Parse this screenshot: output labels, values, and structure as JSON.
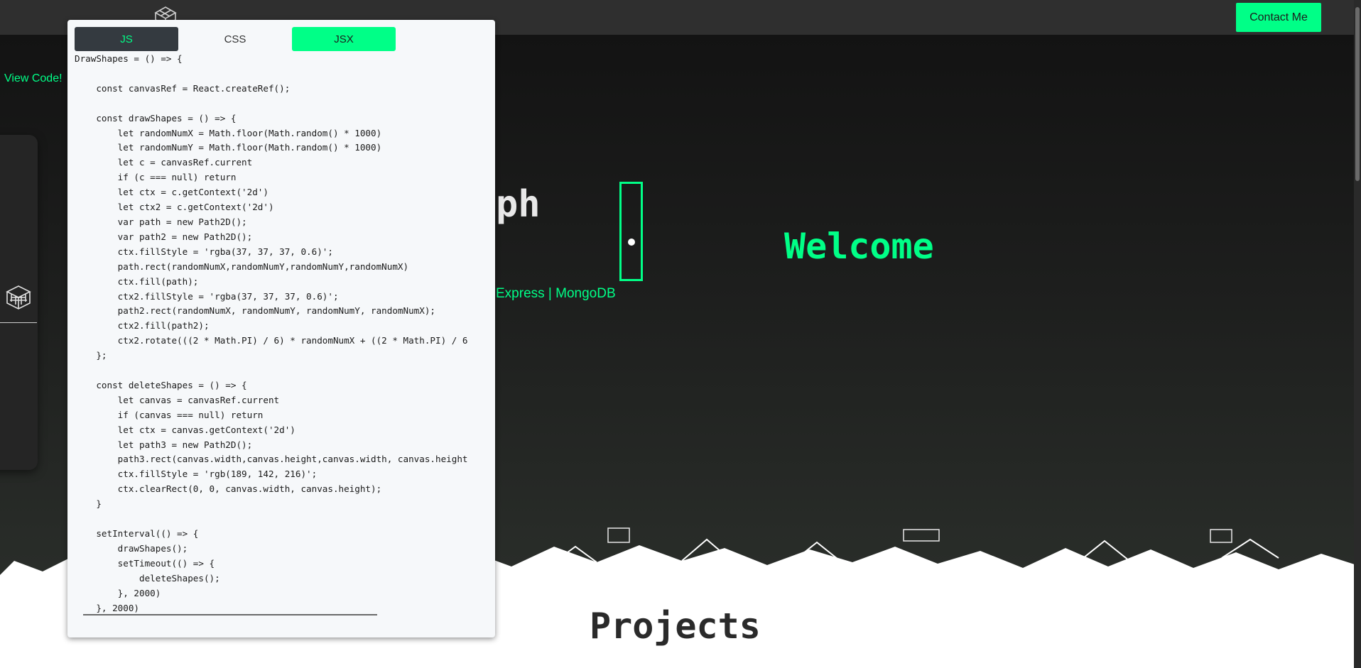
{
  "topbar": {
    "contact_label": "Contact Me"
  },
  "sidebar": {
    "view_code_label": "View Code!"
  },
  "hero": {
    "name_partial": "ph",
    "tech_stack_partial": "Express | MongoDB",
    "welcome": "Welcome"
  },
  "section": {
    "projects_title": "Projects"
  },
  "code_modal": {
    "tabs": [
      {
        "label": "JS",
        "state": "active"
      },
      {
        "label": "CSS",
        "state": "inactive"
      },
      {
        "label": "JSX",
        "state": "highlighted"
      }
    ],
    "code": "DrawShapes = () => {\n\n    const canvasRef = React.createRef();\n\n    const drawShapes = () => {\n        let randomNumX = Math.floor(Math.random() * 1000)\n        let randomNumY = Math.floor(Math.random() * 1000)\n        let c = canvasRef.current\n        if (c === null) return\n        let ctx = c.getContext('2d')\n        let ctx2 = c.getContext('2d')\n        var path = new Path2D();\n        var path2 = new Path2D();\n        ctx.fillStyle = 'rgba(37, 37, 37, 0.6)';\n        path.rect(randomNumX,randomNumY,randomNumY,randomNumX)\n        ctx.fill(path);\n        ctx2.fillStyle = 'rgba(37, 37, 37, 0.6)';\n        path2.rect(randomNumX, randomNumY, randomNumY, randomNumX);\n        ctx2.fill(path2);\n        ctx2.rotate(((2 * Math.PI) / 6) * randomNumX + ((2 * Math.PI) / 6\n    };\n\n    const deleteShapes = () => {\n        let canvas = canvasRef.current\n        if (canvas === null) return\n        let ctx = canvas.getContext('2d')\n        let path3 = new Path2D();\n        path3.rect(canvas.width,canvas.height,canvas.width, canvas.height\n        ctx.fillStyle = 'rgb(189, 142, 216)';\n        ctx.clearRect(0, 0, canvas.width, canvas.height);\n    }\n\n    setInterval(() => {\n        drawShapes();\n        setTimeout(() => {\n            deleteShapes();\n        }, 2000)\n    }, 2000)"
  },
  "colors": {
    "accent": "#00ff87",
    "topbar": "#2f2f2f",
    "hero_bg": "#1a1a1a",
    "modal_bg": "#f6f8fa",
    "tab_dark": "#343a40"
  },
  "icons": [
    "geometric-logo-icon",
    "geometric-logo-icon-side"
  ]
}
